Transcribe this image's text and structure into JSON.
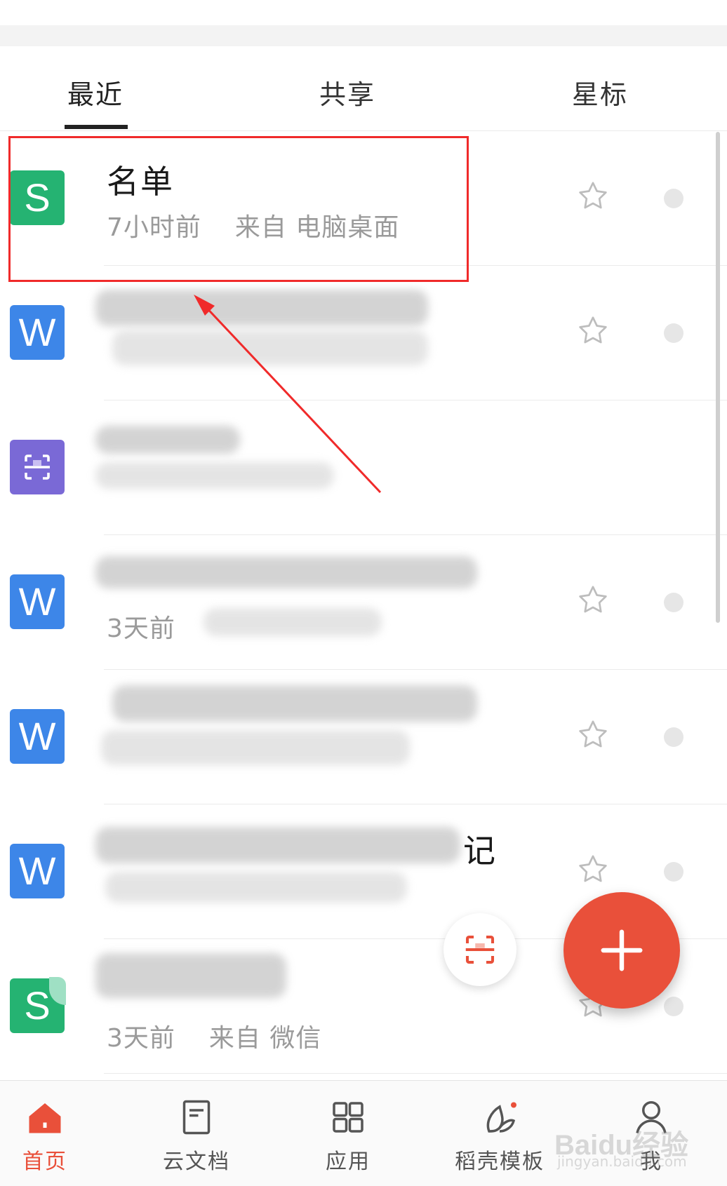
{
  "tabs": [
    {
      "label": "最近",
      "active": true
    },
    {
      "label": "共享",
      "active": false
    },
    {
      "label": "星标",
      "active": false
    }
  ],
  "files": [
    {
      "icon": "S",
      "type": "spreadsheet",
      "title": "名单",
      "time": "7小时前",
      "source": "来自 电脑桌面",
      "starred": false
    },
    {
      "icon": "W",
      "type": "document",
      "title": "",
      "time": "",
      "source": "",
      "starred": false
    },
    {
      "icon": "scan",
      "type": "scan",
      "title": "",
      "time": "",
      "source": "",
      "starred": false
    },
    {
      "icon": "W",
      "type": "document",
      "title": "",
      "time": "3天前",
      "source": "",
      "starred": false
    },
    {
      "icon": "W",
      "type": "document",
      "title": "",
      "time": "",
      "source": "",
      "starred": false
    },
    {
      "icon": "W",
      "type": "document",
      "title": "记",
      "time": "",
      "source": "",
      "starred": false
    },
    {
      "icon": "S",
      "type": "spreadsheet",
      "title": "",
      "time": "3天前",
      "source": "来自 微信",
      "starred": false
    }
  ],
  "fab": {
    "add_icon": "plus-icon",
    "scan_icon": "scan-icon"
  },
  "bottom_nav": [
    {
      "label": "首页",
      "icon": "home-icon",
      "active": true
    },
    {
      "label": "云文档",
      "icon": "cloud-doc-icon",
      "active": false
    },
    {
      "label": "应用",
      "icon": "apps-grid-icon",
      "active": false
    },
    {
      "label": "稻壳模板",
      "icon": "template-leaf-icon",
      "active": false,
      "badge": true
    },
    {
      "label": "我",
      "icon": "profile-icon",
      "active": false
    }
  ],
  "watermark": {
    "text": "Baidu经验",
    "sub": "jingyan.baidu.com"
  },
  "colors": {
    "accent": "#e9503a",
    "sheet": "#25b372",
    "word": "#3d86e8",
    "scan": "#7a69d6",
    "annotation": "#f02a2a"
  }
}
